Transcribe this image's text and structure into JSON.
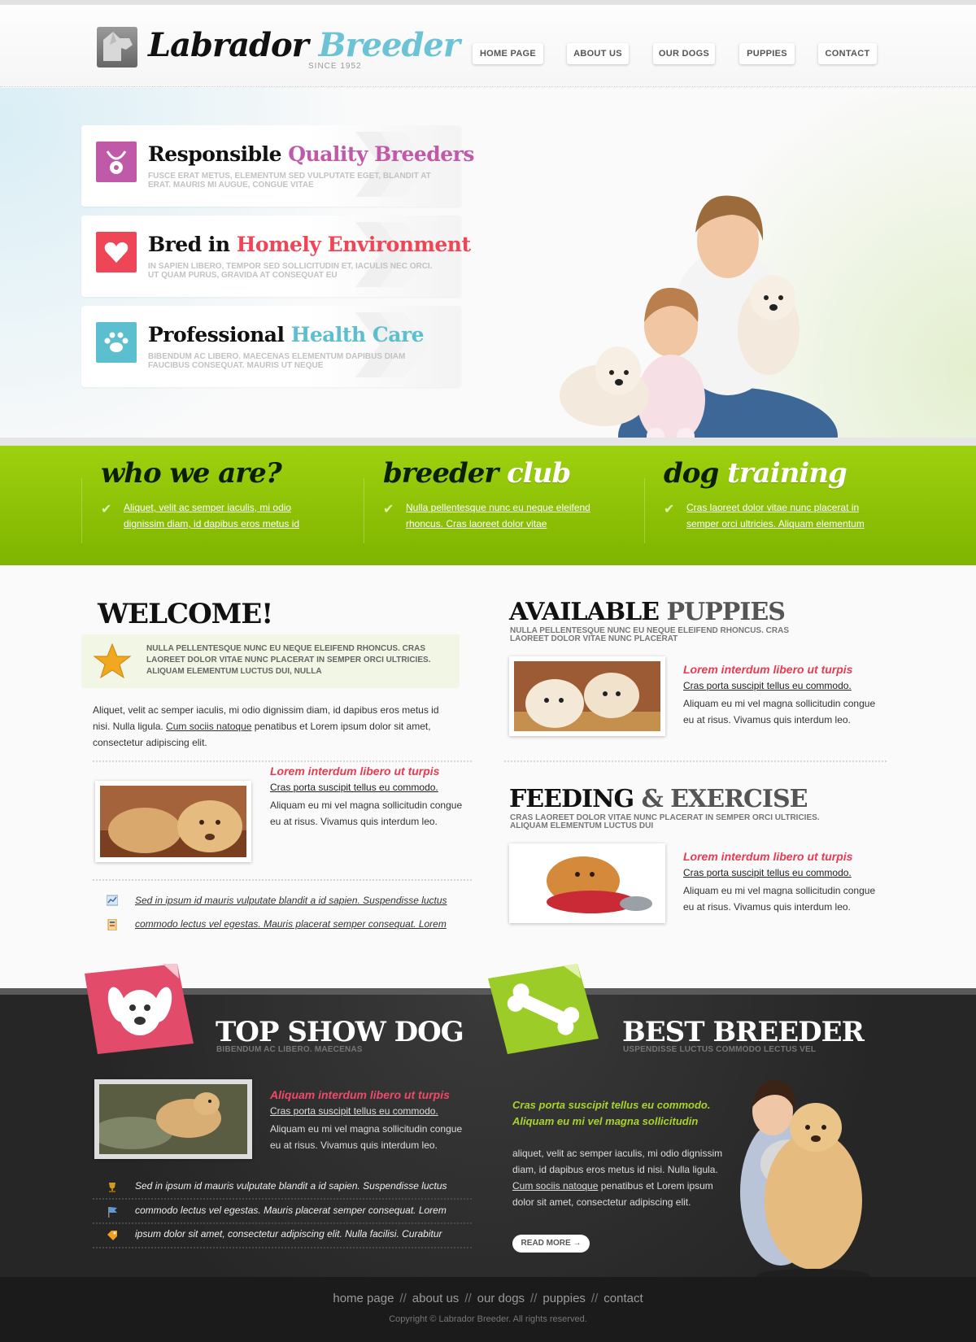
{
  "header": {
    "logo_word1": "Labrador",
    "logo_word2": "Breeder",
    "logo_since": "SINCE 1952",
    "nav": [
      "HOME PAGE",
      "ABOUT US",
      "OUR DOGS",
      "PUPPIES",
      "CONTACT"
    ]
  },
  "hero": {
    "features": [
      {
        "title_a": "Responsible ",
        "title_b": "Quality Breeders",
        "accent": "#c05aa8",
        "icon": "medal-icon",
        "desc": "FUSCE ERAT METUS, ELEMENTUM SED VULPUTATE EGET, BLANDIT AT ERAT. MAURIS MI AUGUE, CONGUE VITAE"
      },
      {
        "title_a": "Bred in ",
        "title_b": "Homely Environment",
        "accent": "#ee4656",
        "icon": "heart-icon",
        "desc": "IN SAPIEN LIBERO, TEMPOR SED SOLLICITUDIN ET, IACULIS NEC ORCI. UT QUAM PURUS, GRAVIDA AT CONSEQUAT EU"
      },
      {
        "title_a": "Professional ",
        "title_b": "Health Care",
        "accent": "#5bbfcf",
        "icon": "paw-icon",
        "desc": "BIBENDUM AC LIBERO. MAECENAS ELEMENTUM DAPIBUS DIAM FAUCIBUS CONSEQUAT. MAURIS UT NEQUE"
      }
    ]
  },
  "green_band": [
    {
      "title_a": "who we are?",
      "title_b": "",
      "text": "Aliquet, velit ac semper iaculis, mi odio dignissim diam, id dapibus eros metus id"
    },
    {
      "title_a": "breeder ",
      "title_b": "club",
      "text": "Nulla pellentesque nunc eu neque eleifend rhoncus. Cras laoreet dolor vitae"
    },
    {
      "title_a": "dog ",
      "title_b": "training",
      "text": "Cras laoreet dolor vitae nunc placerat in semper orci ultricies. Aliquam elementum"
    }
  ],
  "welcome": {
    "title": "WELCOME!",
    "note": "NULLA PELLENTESQUE NUNC EU NEQUE ELEIFEND RHONCUS. CRAS LAOREET DOLOR VITAE NUNC PLACERAT IN SEMPER ORCI ULTRICIES. ALIQUAM ELEMENTUM LUCTUS DUI, NULLA",
    "para_a": "Aliquet, velit ac semper iaculis, mi odio dignissim diam, id dapibus eros metus id nisi. Nulla ligula. ",
    "para_link": "Cum sociis natoque",
    "para_b": " penatibus et Lorem ipsum dolor sit amet, consectetur adipiscing elit.",
    "item_title": "Lorem interdum libero ut turpis",
    "item_link": "Cras porta suscipit tellus eu commodo.",
    "item_text": "Aliquam eu mi vel magna sollicitudin congue eu at risus. Vivamus quis interdum leo.",
    "links": [
      {
        "icon": "chart-icon",
        "text": "Sed in ipsum id mauris vulputate blandit a id sapien. Suspendisse luctus"
      },
      {
        "icon": "document-icon",
        "text": "commodo lectus vel egestas. Mauris placerat semper consequat. Lorem"
      }
    ]
  },
  "puppies": {
    "title_a": "AVAILABLE ",
    "title_b": "PUPPIES",
    "desc": "NULLA PELLENTESQUE NUNC EU NEQUE ELEIFEND RHONCUS. CRAS LAOREET DOLOR VITAE NUNC PLACERAT",
    "item_title": "Lorem interdum libero ut turpis",
    "item_link": "Cras porta suscipit tellus eu commodo.",
    "item_text": "Aliquam eu mi vel magna sollicitudin congue eu at risus. Vivamus quis interdum leo."
  },
  "feeding": {
    "title_a": "FEEDING ",
    "title_b": "& EXERCISE",
    "desc": "CRAS LAOREET DOLOR VITAE NUNC PLACERAT IN SEMPER ORCI ULTRICIES. ALIQUAM ELEMENTUM LUCTUS DUI",
    "item_title": "Lorem interdum libero ut turpis",
    "item_link": "Cras porta suscipit tellus eu commodo.",
    "item_text": "Aliquam eu mi vel magna sollicitudin congue eu at risus. Vivamus quis interdum leo."
  },
  "top_show": {
    "title": "TOP SHOW DOG",
    "sub": "BIBENDUM AC LIBERO. MAECENAS",
    "item_title": "Aliquam interdum libero ut turpis",
    "item_link": "Cras porta suscipit tellus eu commodo.",
    "item_text": "Aliquam eu mi vel magna sollicitudin congue eu at risus. Vivamus quis interdum leo.",
    "links": [
      {
        "icon": "trophy-icon",
        "text": "Sed in ipsum id mauris vulputate blandit a id sapien. Suspendisse luctus"
      },
      {
        "icon": "flag-icon",
        "text": "commodo lectus vel egestas. Mauris placerat semper consequat. Lorem"
      },
      {
        "icon": "tag-icon",
        "text": "ipsum dolor sit amet, consectetur adipiscing elit. Nulla facilisi. Curabitur"
      }
    ]
  },
  "best_breeder": {
    "title": "BEST BREEDER",
    "sub": "USPENDISSE LUCTUS COMMODO LECTUS VEL",
    "lime_1": "Cras porta suscipit tellus eu commodo.",
    "lime_2": "Aliquam eu mi vel magna sollicitudin",
    "para_a": "aliquet, velit ac semper iaculis, mi odio dignissim diam, id dapibus eros metus id nisi. Nulla ligula. ",
    "para_link": "Cum sociis natoque",
    "para_b": " penatibus et Lorem ipsum dolor sit amet, consectetur adipiscing elit.",
    "read_more": "READ MORE →"
  },
  "footer": {
    "nav": [
      "home page",
      "about us",
      "our dogs",
      "puppies",
      "contact"
    ],
    "separator": "//",
    "copyright": "Copyright © Labrador Breeder. All rights reserved."
  },
  "colors": {
    "accent_green": "#8cc20a",
    "accent_pink": "#e63b53",
    "accent_blue": "#6cc3d6",
    "dark_bg": "#2b2b2b"
  }
}
